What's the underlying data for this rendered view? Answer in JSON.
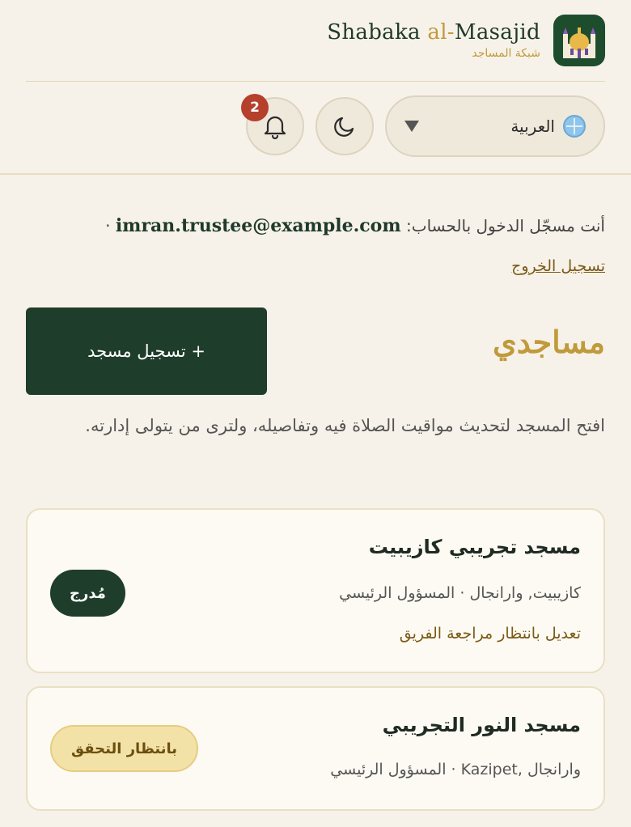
{
  "brand": {
    "title_part1": "Shabaka ",
    "title_accent": "al-",
    "title_part2": "Masajid",
    "subtitle": "شبكة المساجد"
  },
  "controls": {
    "notifications_count": "2",
    "language_label": "العربية"
  },
  "account": {
    "prefix": "أنت مسجّل الدخول بالحساب:",
    "email": "imran.trustee@example.com",
    "separator": "·",
    "logout_label": "تسجيل الخروج"
  },
  "page": {
    "title": "مساجدي",
    "add_button": "+ تسجيل مسجد",
    "description": "افتح المسجد لتحديث مواقيت الصلاة فيه وتفاصيله، ولترى من يتولى إدارته."
  },
  "mosques": [
    {
      "name": "مسجد تجريبي كازيبيت",
      "meta": "كازيبيت, وارانجال · المسؤول الرئيسي",
      "note": "تعديل بانتظار مراجعة الفريق",
      "status": "مُدرج"
    },
    {
      "name": "مسجد النور التجريبي",
      "meta": "وارانجال ,Kazipet · المسؤول الرئيسي",
      "status": "بانتظار التحقق"
    }
  ],
  "colors": {
    "background": "#f7f2e9",
    "primary": "#1e3d2a",
    "accent": "#c09a3c",
    "badge": "#b5402c"
  },
  "icons": [
    "mosque-logo-icon",
    "bell-icon",
    "moon-icon",
    "globe-icon",
    "caret-down-icon"
  ]
}
